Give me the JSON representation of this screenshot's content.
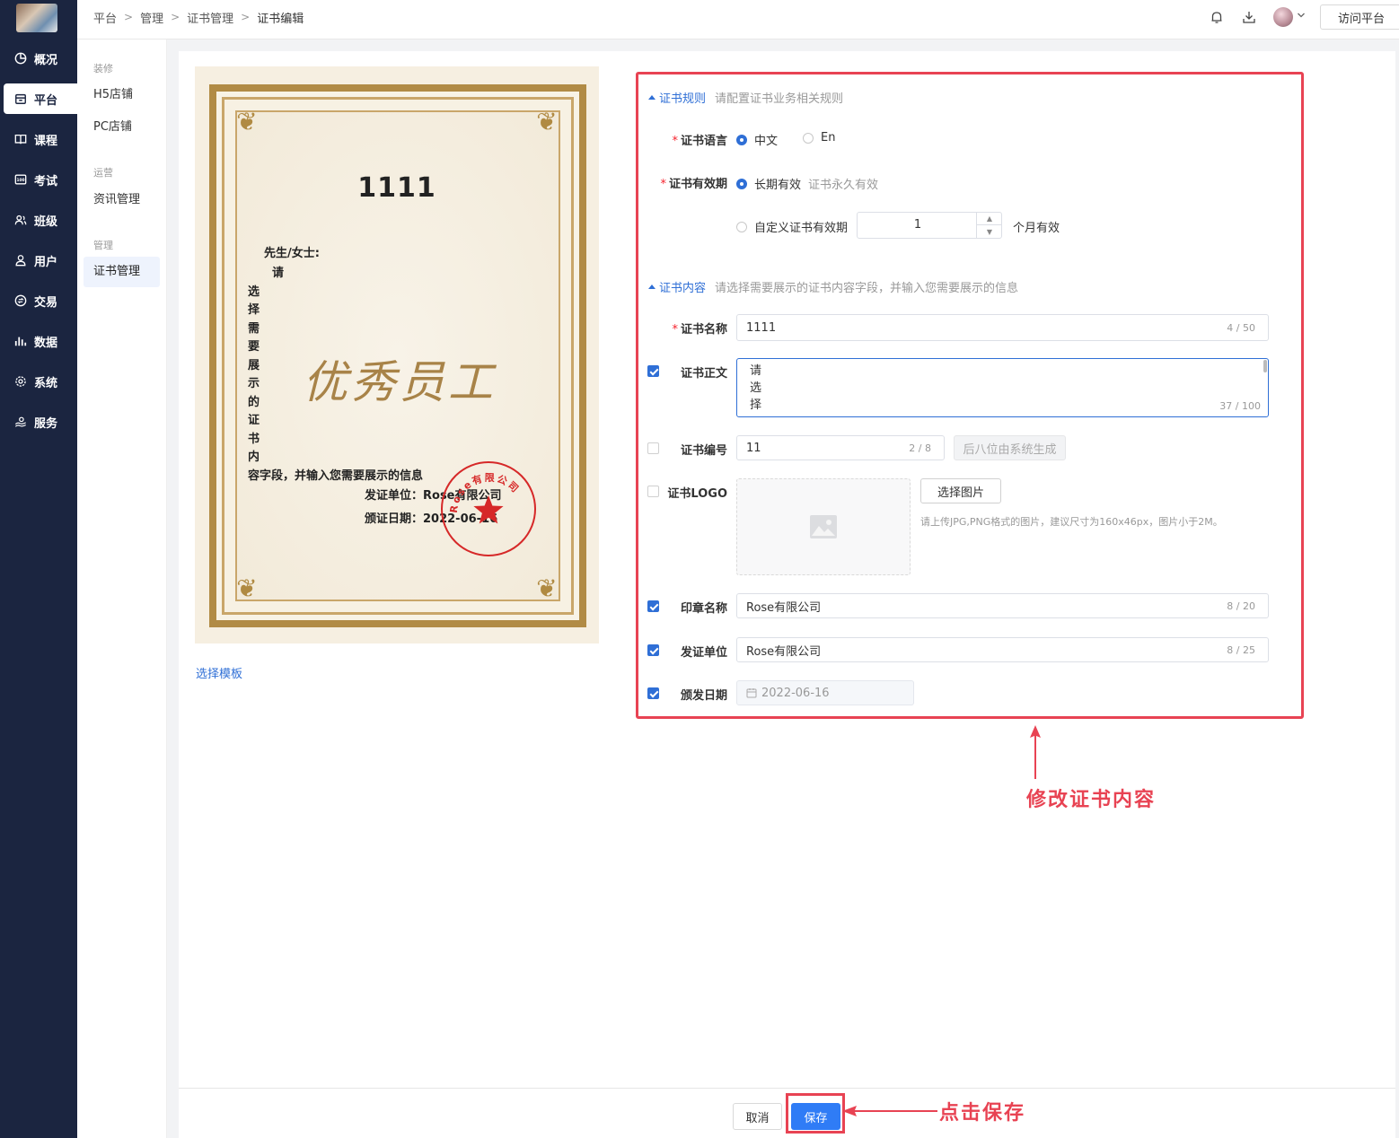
{
  "nav": {
    "items": [
      {
        "label": "概况",
        "icon": "pie-chart-icon"
      },
      {
        "label": "平台",
        "icon": "store-icon",
        "active": true
      },
      {
        "label": "课程",
        "icon": "book-icon"
      },
      {
        "label": "考试",
        "icon": "exam-icon"
      },
      {
        "label": "班级",
        "icon": "class-icon"
      },
      {
        "label": "用户",
        "icon": "user-icon"
      },
      {
        "label": "交易",
        "icon": "transaction-icon"
      },
      {
        "label": "数据",
        "icon": "bar-chart-icon"
      },
      {
        "label": "系统",
        "icon": "gear-icon"
      },
      {
        "label": "服务",
        "icon": "service-icon"
      }
    ]
  },
  "submenu": {
    "groups": [
      "装修",
      "运营",
      "管理"
    ],
    "items": [
      "H5店铺",
      "PC店铺",
      "资讯管理",
      "证书管理"
    ]
  },
  "breadcrumb": [
    "平台",
    "管理",
    "证书管理",
    "证书编辑"
  ],
  "topbar": {
    "visit_label": "访问平台"
  },
  "certificate": {
    "title": "1111",
    "salutation": "先生/女士:",
    "body_first": "请",
    "body_chars": [
      "选",
      "择",
      "需",
      "要",
      "展",
      "示",
      "的",
      "证",
      "书",
      "内"
    ],
    "body_last": "容字段，并输入您需要展示的信息",
    "calligraphy": "优秀员工",
    "issuer": "发证单位：Rose有限公司",
    "date": "颁证日期：2022-06-16",
    "seal_text": "Rose有限公司"
  },
  "choose_template": "选择模板",
  "rules_section": {
    "title": "证书规则",
    "desc": "请配置证书业务相关规则"
  },
  "language": {
    "label": "证书语言",
    "opt_cn": "中文",
    "opt_en": "En"
  },
  "validity": {
    "label": "证书有效期",
    "opt_long": "长期有效",
    "opt_long_hint": "证书永久有效",
    "opt_custom": "自定义证书有效期",
    "months": "1",
    "months_suffix": "个月有效"
  },
  "content_section": {
    "title": "证书内容",
    "desc": "请选择需要展示的证书内容字段，并输入您需要展示的信息"
  },
  "fields": {
    "name": {
      "label": "证书名称",
      "value": "1111",
      "count": "4 / 50"
    },
    "body": {
      "label": "证书正文",
      "lines": [
        "请",
        "选",
        "择"
      ],
      "count": "37 / 100"
    },
    "number": {
      "label": "证书编号",
      "value": "11",
      "count": "2 / 8",
      "suffix_btn": "后八位由系统生成"
    },
    "logo": {
      "label": "证书LOGO",
      "pick_btn": "选择图片",
      "tip": "请上传JPG,PNG格式的图片，建议尺寸为160x46px，图片小于2M。"
    },
    "seal": {
      "label": "印章名称",
      "value": "Rose有限公司",
      "count": "8 / 20"
    },
    "issuer": {
      "label": "发证单位",
      "value": "Rose有限公司",
      "count": "8 / 25"
    },
    "date": {
      "label": "颁发日期",
      "value": "2022-06-16"
    }
  },
  "annotations": {
    "modify": "修改证书内容",
    "save": "点击保存"
  },
  "footer": {
    "cancel": "取消",
    "save": "保存"
  },
  "colors": {
    "nav_bg": "#1b2540",
    "accent": "#2f6fd6",
    "annotation": "#e84353",
    "primary_button": "#2f7cf6"
  }
}
